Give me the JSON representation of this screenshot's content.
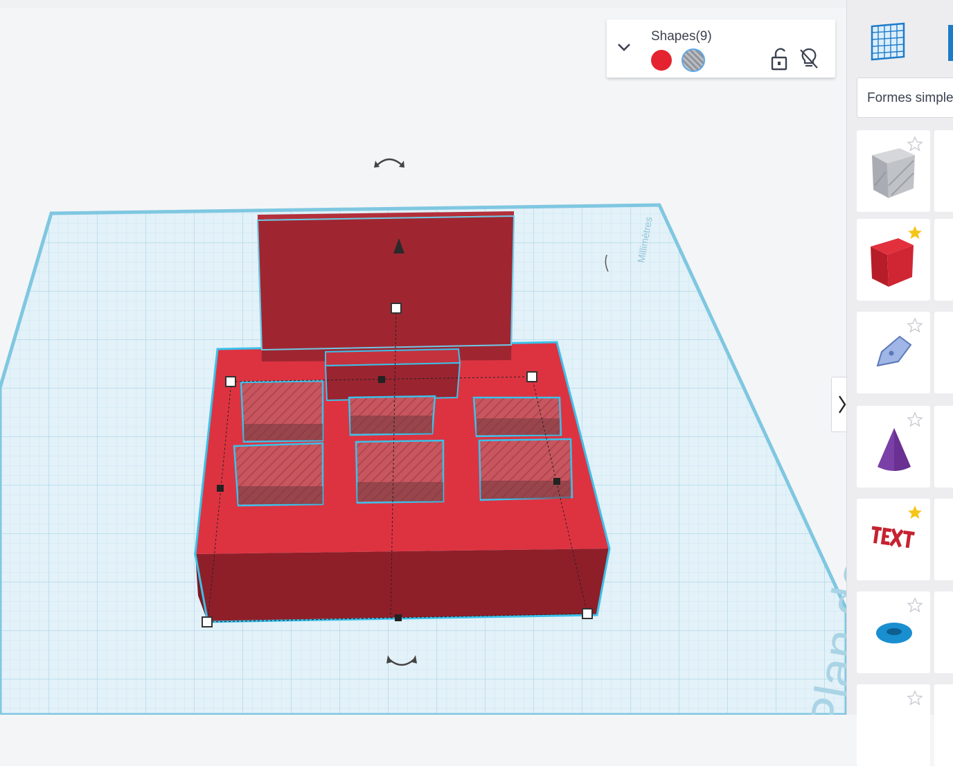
{
  "inspector": {
    "title": "Shapes(9)",
    "colors": {
      "solid": "#e52330",
      "hole": "#b9bcc2"
    }
  },
  "workplane": {
    "unit_label": "Millimètres",
    "plane_label": "Plan de construction"
  },
  "sidebar": {
    "category": "Formes simples",
    "shapes": [
      {
        "icon": "box-hole-icon",
        "favorite": false
      },
      {
        "icon": "box-icon",
        "favorite": true
      },
      {
        "icon": "scribble-icon",
        "favorite": false
      },
      {
        "icon": "cone-icon",
        "favorite": false
      },
      {
        "icon": "text-icon",
        "favorite": true
      },
      {
        "icon": "torus-icon",
        "favorite": false
      },
      {
        "icon": "more-shape-icon",
        "favorite": false
      }
    ]
  }
}
